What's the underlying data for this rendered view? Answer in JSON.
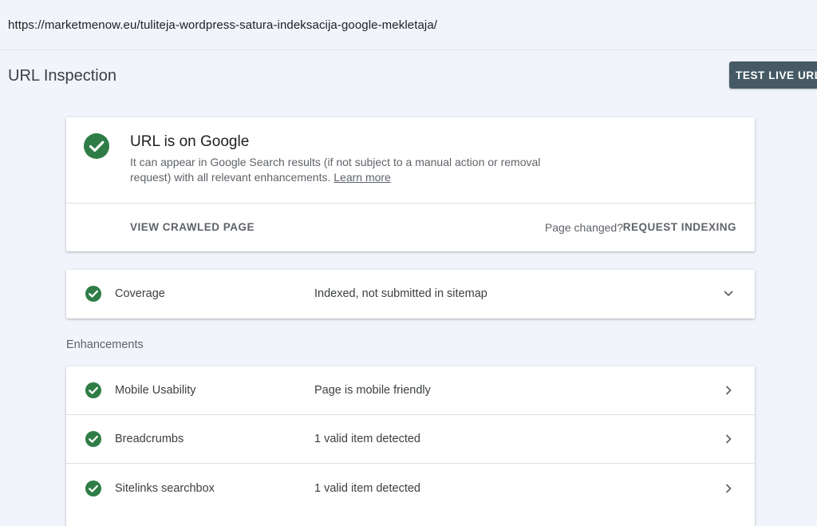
{
  "url": "https://marketmenow.eu/tuliteja-wordpress-satura-indeksacija-google-mekletaja/",
  "page_title": "URL Inspection",
  "test_live_label": "TEST LIVE URL",
  "status": {
    "icon": "check-circle-icon",
    "title": "URL is on Google",
    "description": "It can appear in Google Search results (if not subject to a manual action or removal request) with all relevant enhancements.",
    "learn_more": "Learn more",
    "view_crawled": "VIEW CRAWLED PAGE",
    "page_changed": "Page changed?",
    "request_indexing": "REQUEST INDEXING"
  },
  "coverage": {
    "label": "Coverage",
    "value": "Indexed, not submitted in sitemap",
    "icon": "check-circle-icon",
    "expand_icon": "chevron-down-icon"
  },
  "enhancements": {
    "heading": "Enhancements",
    "items": [
      {
        "label": "Mobile Usability",
        "value": "Page is mobile friendly"
      },
      {
        "label": "Breadcrumbs",
        "value": "1 valid item detected"
      },
      {
        "label": "Sitelinks searchbox",
        "value": "1 valid item detected"
      }
    ]
  },
  "colors": {
    "success_green": "#2e7d46",
    "button_bg": "#455a64",
    "page_bg": "#f1f4fa"
  }
}
